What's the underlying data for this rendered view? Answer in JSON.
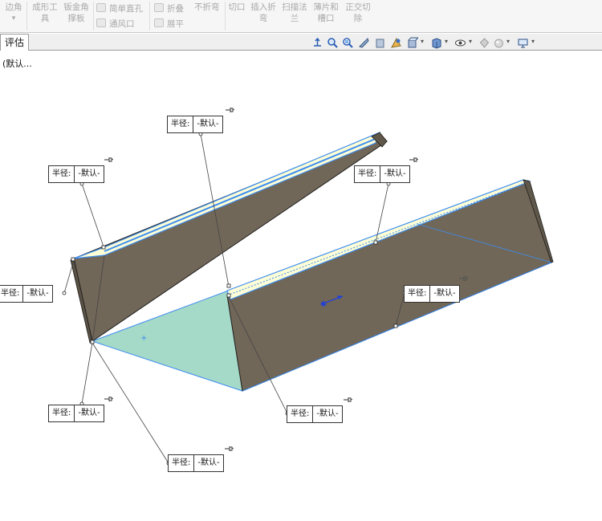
{
  "ribbon": {
    "edge": "边角",
    "edge_dd": "▾",
    "forming_tool": [
      "成形工",
      "具"
    ],
    "gusset": [
      "钣金角",
      "撑板"
    ],
    "simple_hole": "简单直孔",
    "vent": "通风口",
    "fold": "折叠",
    "unfold": "展平",
    "no_bend": "不折弯",
    "cut": "切口",
    "insert_bend": [
      "插入折",
      "弯"
    ],
    "sweep_flange": [
      "扫描法",
      "兰"
    ],
    "lofted_bend": [
      "薄片和",
      "槽口"
    ],
    "normal_cut": [
      "正交切",
      "除"
    ]
  },
  "tab": {
    "label": "评估"
  },
  "status": {
    "text": "(默认..."
  },
  "view_toolbar": {
    "icons": [
      "view-orientation-icon",
      "zoom-to-fit-icon",
      "zoom-area-icon",
      "previous-view-icon",
      "section-view-icon",
      "dynamic-annotation-icon",
      "view-orientation-cube-icon",
      "display-style-icon",
      "hide-show-items-icon",
      "edit-appearance-icon",
      "apply-scene-icon",
      "view-settings-icon"
    ]
  },
  "colors": {
    "part_body": "#716758",
    "part_bottom": "#a6dac8",
    "part_lip": "#fdfdd6",
    "selection_edge": "#3c8cf0",
    "part_edge": "#1d1d1d"
  },
  "callouts": [
    {
      "label": "半径:",
      "value": "-默认-"
    },
    {
      "label": "半径:",
      "value": "-默认-"
    },
    {
      "label": "半径:",
      "value": "-默认-"
    },
    {
      "label": "半径:",
      "value": "-默认-"
    },
    {
      "label": "半径:",
      "value": "-默认-"
    },
    {
      "label": "半径:",
      "value": "-默认-"
    },
    {
      "label": "半径:",
      "value": "-默认-"
    },
    {
      "label": "半径:",
      "value": "-默认-"
    }
  ]
}
